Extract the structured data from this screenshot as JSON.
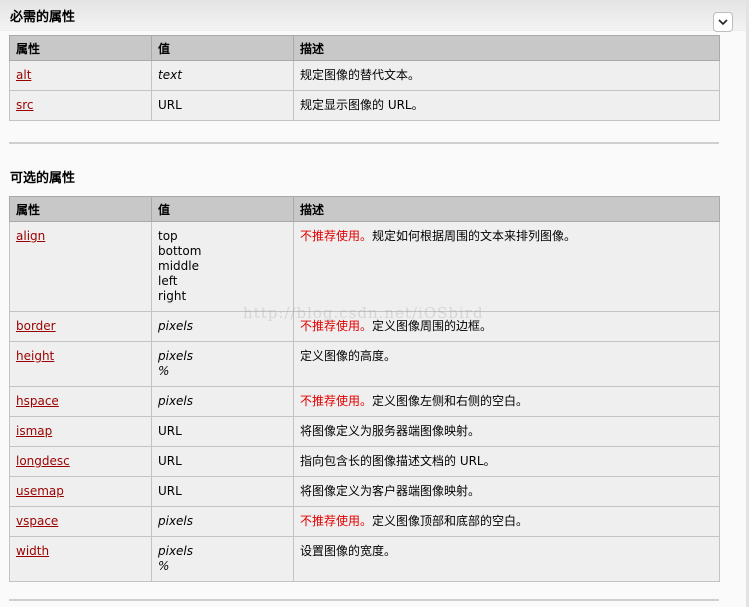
{
  "required": {
    "title": "必需的属性",
    "headers": [
      "属性",
      "值",
      "描述"
    ],
    "rows": [
      {
        "attr": "alt",
        "value": "text",
        "desc": "规定图像的替代文本。"
      },
      {
        "attr": "src",
        "value": "URL",
        "desc": "规定显示图像的 URL。"
      }
    ]
  },
  "optional": {
    "title": "可选的属性",
    "headers": [
      "属性",
      "值",
      "描述"
    ],
    "rows": [
      {
        "attr": "align",
        "value": [
          "top",
          "bottom",
          "middle",
          "left",
          "right"
        ],
        "deprecated": "不推荐使用。",
        "desc": "规定如何根据周围的文本来排列图像。"
      },
      {
        "attr": "border",
        "value": [
          "pixels"
        ],
        "deprecated": "不推荐使用。",
        "desc": "定义图像周围的边框。"
      },
      {
        "attr": "height",
        "value": [
          "pixels",
          "%"
        ],
        "deprecated": "",
        "desc": "定义图像的高度。"
      },
      {
        "attr": "hspace",
        "value": [
          "pixels"
        ],
        "deprecated": "不推荐使用。",
        "desc": "定义图像左侧和右侧的空白。"
      },
      {
        "attr": "ismap",
        "value": [
          "URL"
        ],
        "deprecated": "",
        "desc": "将图像定义为服务器端图像映射。"
      },
      {
        "attr": "longdesc",
        "value": [
          "URL"
        ],
        "deprecated": "",
        "desc": "指向包含长的图像描述文档的 URL。"
      },
      {
        "attr": "usemap",
        "value": [
          "URL"
        ],
        "deprecated": "",
        "desc": "将图像定义为客户器端图像映射。"
      },
      {
        "attr": "vspace",
        "value": [
          "pixels"
        ],
        "deprecated": "不推荐使用。",
        "desc": "定义图像顶部和底部的空白。"
      },
      {
        "attr": "width",
        "value": [
          "pixels",
          "%"
        ],
        "deprecated": "",
        "desc": "设置图像的宽度。"
      }
    ]
  },
  "watermark": "http://blog.csdn.net/iOSbird",
  "icons": {
    "dropdown": "chevron-down-icon"
  }
}
